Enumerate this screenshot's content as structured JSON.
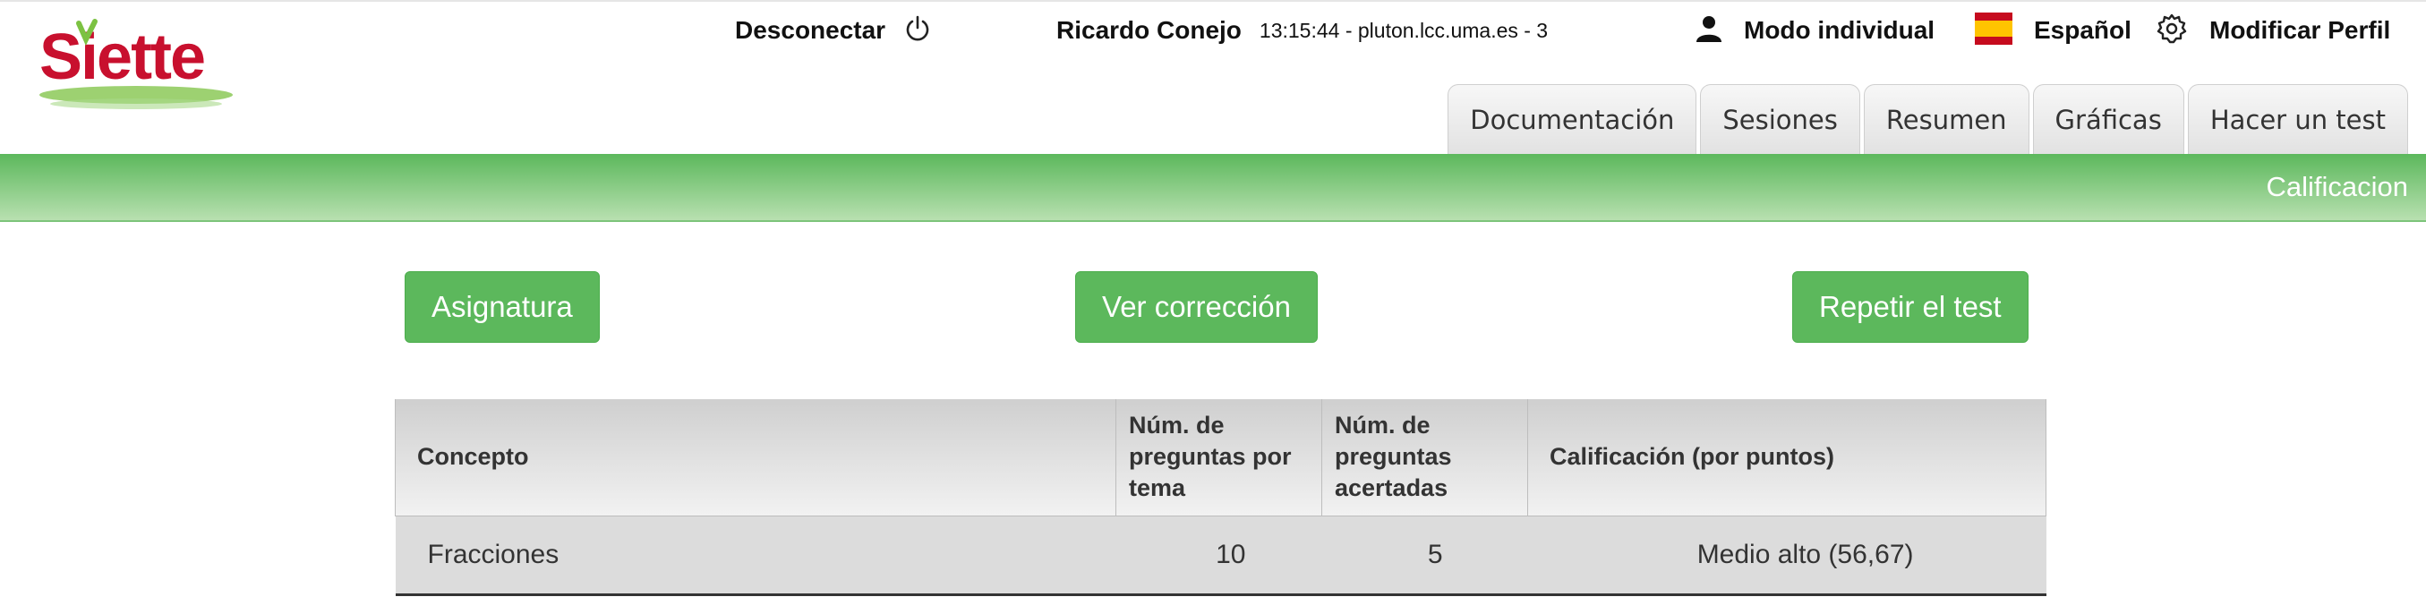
{
  "header": {
    "logo_text": "Siette",
    "logout_label": "Desconectar",
    "user_name": "Ricardo Conejo",
    "session_info": "13:15:44 - pluton.lcc.uma.es - 3",
    "mode_label": "Modo individual",
    "language_label": "Español",
    "profile_label": "Modificar Perfil"
  },
  "tabs": [
    {
      "label": "Documentación"
    },
    {
      "label": "Sesiones"
    },
    {
      "label": "Resumen"
    },
    {
      "label": "Gráficas"
    },
    {
      "label": "Hacer un test"
    }
  ],
  "page_title": "Calificacion",
  "buttons": {
    "subject": "Asignatura",
    "view_correction": "Ver corrección",
    "repeat_test": "Repetir el test"
  },
  "table": {
    "headers": [
      "Concepto",
      "Núm. de preguntas por tema",
      "Núm. de preguntas acertadas",
      "Calificación (por puntos)"
    ],
    "rows": [
      [
        "Fracciones",
        "10",
        "5",
        "Medio alto (56,67)"
      ]
    ]
  },
  "colors": {
    "accent_green": "#5cb85c",
    "logo_red": "#c8102e",
    "logo_green": "#7cc242"
  },
  "icons": {
    "logout": "power-icon",
    "user": "user-icon",
    "language": "spain-flag-icon",
    "profile": "gear-icon"
  }
}
